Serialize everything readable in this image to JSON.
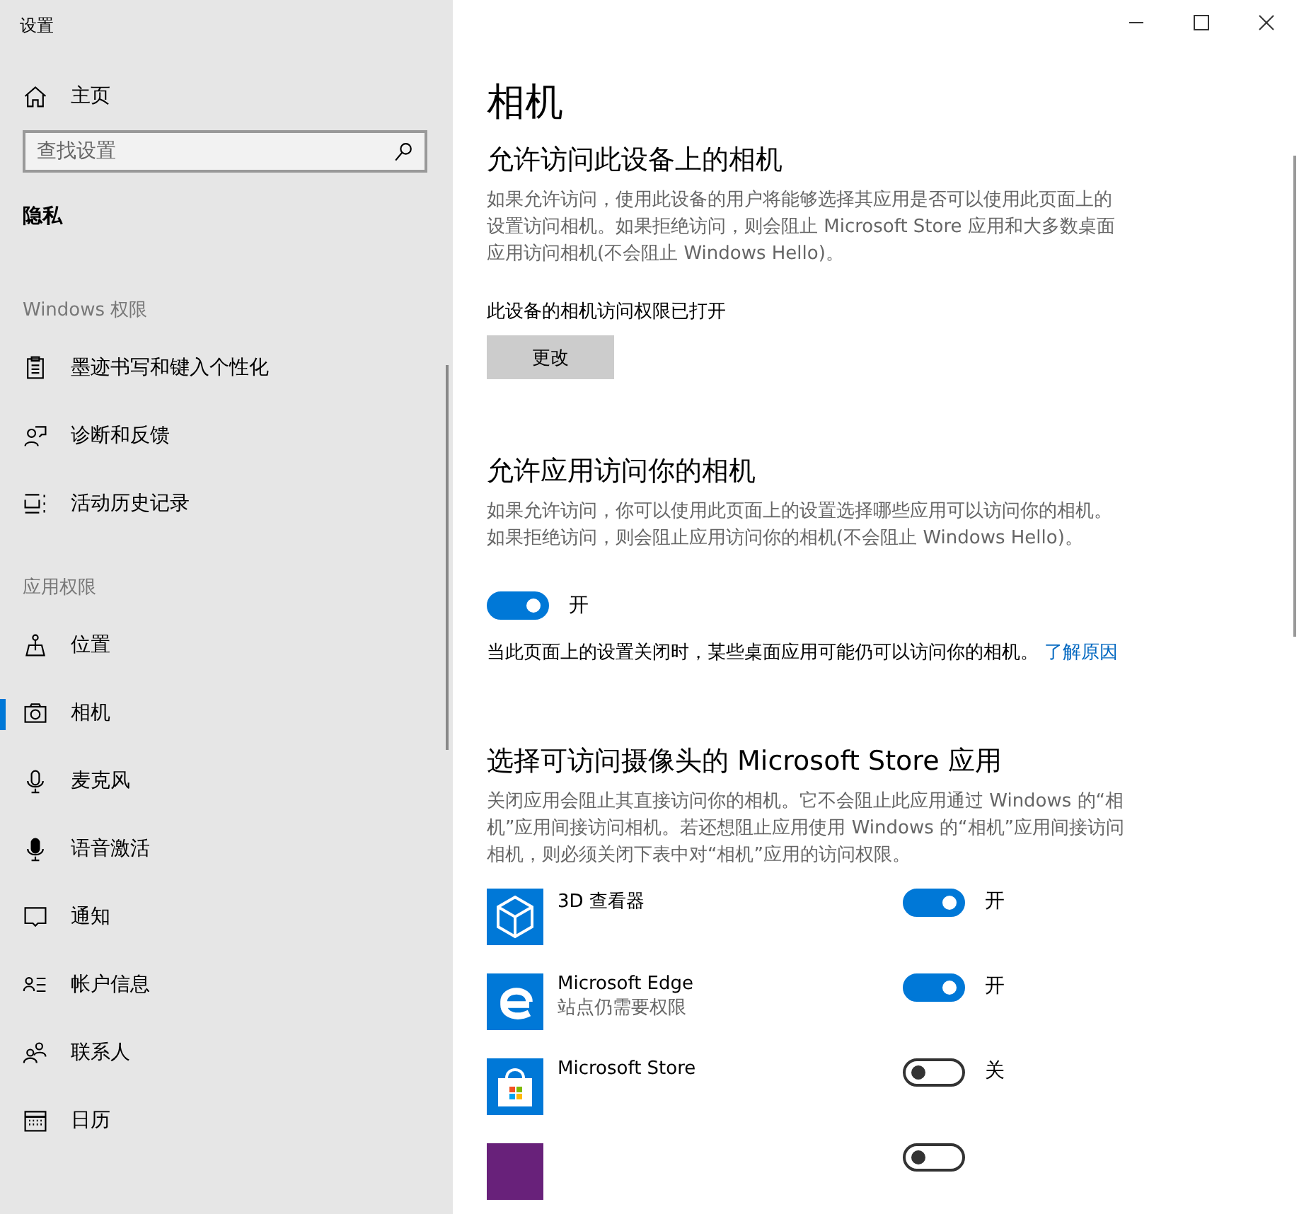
{
  "window": {
    "title": "设置"
  },
  "sidebar": {
    "home": "主页",
    "search": {
      "placeholder": "查找设置"
    },
    "category": "隐私",
    "sections": [
      {
        "header": "Windows 权限",
        "items": [
          {
            "label": "墨迹书写和键入个性化",
            "selected": false
          },
          {
            "label": "诊断和反馈",
            "selected": false
          },
          {
            "label": "活动历史记录",
            "selected": false
          }
        ]
      },
      {
        "header": "应用权限",
        "items": [
          {
            "label": "位置",
            "selected": false
          },
          {
            "label": "相机",
            "selected": true
          },
          {
            "label": "麦克风",
            "selected": false
          },
          {
            "label": "语音激活",
            "selected": false
          },
          {
            "label": "通知",
            "selected": false
          },
          {
            "label": "帐户信息",
            "selected": false
          },
          {
            "label": "联系人",
            "selected": false
          },
          {
            "label": "日历",
            "selected": false
          }
        ]
      }
    ]
  },
  "page": {
    "title": "相机",
    "device_section": {
      "heading": "允许访问此设备上的相机",
      "description": "如果允许访问，使用此设备的用户将能够选择其应用是否可以使用此页面上的设置访问相机。如果拒绝访问，则会阻止 Microsoft Store 应用和大多数桌面应用访问相机(不会阻止 Windows Hello)。",
      "status": "此设备的相机访问权限已打开",
      "button": "更改"
    },
    "apps_section": {
      "heading": "允许应用访问你的相机",
      "description": "如果允许访问，你可以使用此页面上的设置选择哪些应用可以访问你的相机。如果拒绝访问，则会阻止应用访问你的相机(不会阻止 Windows Hello)。",
      "toggle": {
        "on": true,
        "label": "开"
      },
      "note": "当此页面上的设置关闭时，某些桌面应用可能仍可以访问你的相机。",
      "link": "了解原因"
    },
    "store_section": {
      "heading": "选择可访问摄像头的 Microsoft Store 应用",
      "description": "关闭应用会阻止其直接访问你的相机。它不会阻止此应用通过 Windows 的“相机”应用间接访问相机。若还想阻止应用使用 Windows 的“相机”应用间接访问相机，则必须关闭下表中对“相机”应用的访问权限。",
      "apps": [
        {
          "name": "3D 查看器",
          "on": true,
          "state": "开",
          "color": "#0078d7"
        },
        {
          "name": "Microsoft Edge",
          "subtitle": "站点仍需要权限",
          "on": true,
          "state": "开",
          "color": "#0078d7"
        },
        {
          "name": "Microsoft Store",
          "on": false,
          "state": "关",
          "color": "#0078d7"
        },
        {
          "on": false,
          "color": "#68217a"
        }
      ]
    }
  }
}
